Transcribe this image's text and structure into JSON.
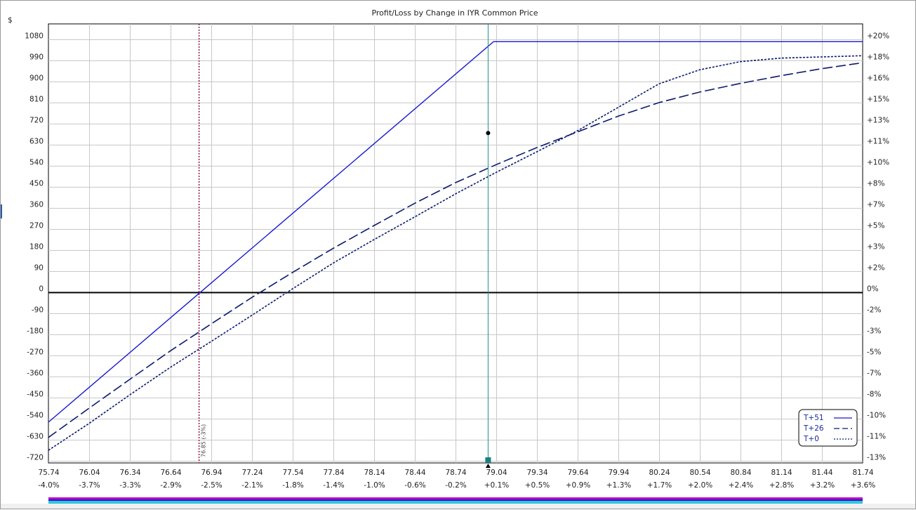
{
  "chart_data": {
    "type": "line",
    "title": "Profit/Loss by Change in IYR Common Price",
    "ylabel": "$",
    "xlim": [
      75.74,
      81.74
    ],
    "ylim": [
      -720,
      1170
    ],
    "x_ticks": [
      75.74,
      76.04,
      76.34,
      76.64,
      76.94,
      77.24,
      77.54,
      77.84,
      78.14,
      78.44,
      78.74,
      79.04,
      79.34,
      79.64,
      79.94,
      80.24,
      80.54,
      80.84,
      81.14,
      81.44,
      81.74
    ],
    "x_tick_labels": [
      "75.74",
      "76.04",
      "76.34",
      "76.64",
      "76.94",
      "77.24",
      "77.54",
      "77.84",
      "78.14",
      "78.44",
      "78.74",
      "79.04",
      "79.34",
      "79.64",
      "79.94",
      "80.24",
      "80.54",
      "80.84",
      "81.14",
      "81.44",
      "81.74"
    ],
    "x_pct_labels": [
      "-4.0%",
      "-3.7%",
      "-3.3%",
      "-2.9%",
      "-2.5%",
      "-2.1%",
      "-1.8%",
      "-1.4%",
      "-1.0%",
      "-0.6%",
      "-0.2%",
      "+0.1%",
      "+0.5%",
      "+0.9%",
      "+1.3%",
      "+1.7%",
      "+2.0%",
      "+2.4%",
      "+2.8%",
      "+3.2%",
      "+3.6%"
    ],
    "y_ticks": [
      1080,
      990,
      900,
      810,
      720,
      630,
      540,
      450,
      360,
      270,
      180,
      90,
      0,
      -90,
      -180,
      -270,
      -360,
      -450,
      -540,
      -630,
      -720
    ],
    "y_tick_labels": [
      "1080",
      "990",
      "900",
      "810",
      "720",
      "630",
      "540",
      "450",
      "360",
      "270",
      "180",
      "90",
      "0",
      "-90",
      "-180",
      "-270",
      "-360",
      "-450",
      "-540",
      "-630",
      "-720"
    ],
    "y_pct_labels": [
      "+20%",
      "+18%",
      "+16%",
      "+15%",
      "+13%",
      "+11%",
      "+10%",
      "+8%",
      "+7%",
      "+5%",
      "+3%",
      "+2%",
      "0%",
      "-2%",
      "-3%",
      "-5%",
      "-7%",
      "-8%",
      "-10%",
      "-11%",
      "-13%"
    ],
    "series": [
      {
        "name": "T+51",
        "style": "solid",
        "color": "#1a1ad0",
        "x": [
          75.74,
          79.02,
          81.74
        ],
        "y": [
          -555,
          1070,
          1070
        ]
      },
      {
        "name": "T+26",
        "style": "dashed",
        "color": "#0a1a6e",
        "x": [
          75.74,
          76.04,
          76.34,
          76.64,
          76.94,
          77.24,
          77.54,
          77.84,
          78.14,
          78.44,
          78.74,
          79.04,
          79.34,
          79.64,
          79.94,
          80.24,
          80.54,
          80.84,
          81.14,
          81.44,
          81.74
        ],
        "y": [
          -620,
          -495,
          -372,
          -250,
          -135,
          -22,
          85,
          188,
          285,
          380,
          468,
          545,
          618,
          685,
          752,
          810,
          855,
          892,
          925,
          955,
          980
        ]
      },
      {
        "name": "T+0",
        "style": "dotted",
        "color": "#0a1a6e",
        "x": [
          75.74,
          76.04,
          76.34,
          76.64,
          76.94,
          77.24,
          77.54,
          77.84,
          78.14,
          78.44,
          78.74,
          79.04,
          79.34,
          79.64,
          79.94,
          80.24,
          80.54,
          80.84,
          81.14,
          81.44,
          81.74
        ],
        "y": [
          -675,
          -560,
          -438,
          -320,
          -210,
          -98,
          15,
          125,
          225,
          322,
          420,
          512,
          600,
          690,
          790,
          890,
          950,
          985,
          1000,
          1005,
          1010
        ]
      }
    ],
    "markers": {
      "current_price_x": 78.98,
      "break_even_x": 76.85,
      "break_even_label": "76.85 (-3%)",
      "dot": {
        "x": 78.98,
        "y": 680
      }
    },
    "legend": {
      "position": "bottom-right",
      "entries": [
        "T+51",
        "T+26",
        "T+0"
      ]
    },
    "grid": true,
    "colors": {
      "grid": "#c8c8c8",
      "zero_line": "#000000",
      "current_price_line": "#1f8f8f",
      "break_even_line": "#8b1a4a",
      "scrollbar_magenta": "#c000c0",
      "scrollbar_cyan": "#30c8d8",
      "scrollbar_blue": "#2020d0"
    }
  }
}
